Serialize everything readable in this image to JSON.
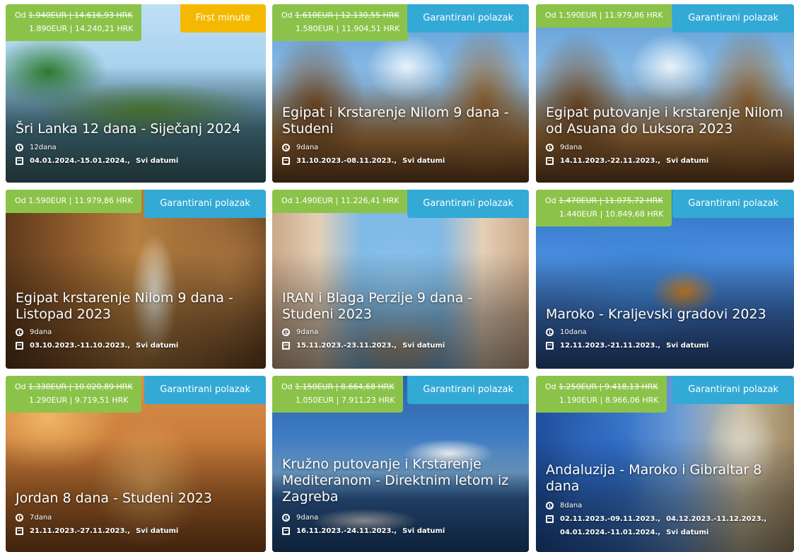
{
  "cards": [
    {
      "price": {
        "prefix": "Od",
        "old": "1.940EUR | 14.616,93 HRK",
        "new": "1.890EUR | 14.240,21 HRK"
      },
      "badge": "First minute",
      "title": "Šri Lanka 12 dana - Siječanj 2024",
      "duration": "12dana",
      "dates": "04.01.2024.-15.01.2024.,",
      "all_dates": "Svi datumi"
    },
    {
      "price": {
        "prefix": "Od",
        "old": "1.610EUR | 12.130,55 HRK",
        "new": "1.580EUR | 11.904,51 HRK"
      },
      "badge": "Garantirani polazak",
      "title": "Egipat i Krstarenje Nilom 9 dana - Studeni",
      "duration": "9dana",
      "dates": "31.10.2023.-08.11.2023.,",
      "all_dates": "Svi datumi"
    },
    {
      "price": {
        "prefix": "Od",
        "single": "1.590EUR | 11.979,86 HRK"
      },
      "badge": "Garantirani polazak",
      "title": "Egipat putovanje i krstarenje Nilom od Asuana do Luksora 2023",
      "duration": "9dana",
      "dates": "14.11.2023.-22.11.2023.,",
      "all_dates": "Svi datumi"
    },
    {
      "price": {
        "prefix": "Od",
        "single": "1.590EUR | 11.979,86 HRK"
      },
      "badge": "Garantirani polazak",
      "title": "Egipat krstarenje Nilom 9 dana - Listopad 2023",
      "duration": "9dana",
      "dates": "03.10.2023.-11.10.2023.,",
      "all_dates": "Svi datumi"
    },
    {
      "price": {
        "prefix": "Od",
        "single": "1.490EUR | 11.226,41 HRK"
      },
      "badge": "Garantirani polazak",
      "title": "IRAN i Blaga Perzije 9 dana - Studeni 2023",
      "duration": "9dana",
      "dates": "15.11.2023.-23.11.2023.,",
      "all_dates": "Svi datumi"
    },
    {
      "price": {
        "prefix": "Od",
        "old": "1.470EUR | 11.075,72 HRK",
        "new": "1.440EUR | 10.849,68 HRK"
      },
      "badge": "Garantirani polazak",
      "title": "Maroko - Kraljevski gradovi 2023",
      "duration": "10dana",
      "dates": "12.11.2023.-21.11.2023.,",
      "all_dates": "Svi datumi"
    },
    {
      "price": {
        "prefix": "Od",
        "old": "1.330EUR | 10.020,89 HRK",
        "new": "1.290EUR | 9.719,51 HRK"
      },
      "badge": "Garantirani polazak",
      "title": "Jordan 8 dana - Studeni 2023",
      "duration": "7dana",
      "dates": "21.11.2023.-27.11.2023.,",
      "all_dates": "Svi datumi"
    },
    {
      "price": {
        "prefix": "Od",
        "old": "1.150EUR | 8.664,68 HRK",
        "new": "1.050EUR | 7.911,23 HRK"
      },
      "badge": "Garantirani polazak",
      "title": "Kružno putovanje i Krstarenje Mediteranom - Direktnim letom iz Zagreba",
      "duration": "9dana",
      "dates": "16.11.2023.-24.11.2023.,",
      "all_dates": "Svi datumi"
    },
    {
      "price": {
        "prefix": "Od",
        "old": "1.250EUR | 9.418,13 HRK",
        "new": "1.190EUR | 8.966,06 HRK"
      },
      "badge": "Garantirani polazak",
      "title": "Andaluzija - Maroko i Gibraltar 8 dana",
      "duration": "8dana",
      "dates": "02.11.2023.-09.11.2023.,",
      "dates2": "04.12.2023.-11.12.2023.,",
      "dates3": "04.01.2024.-11.01.2024.,",
      "all_dates": "Svi datumi"
    }
  ],
  "colors": {
    "price_green": "#8bc34a",
    "badge_blue": "#33a9d6",
    "badge_yellow": "#f5b800"
  }
}
